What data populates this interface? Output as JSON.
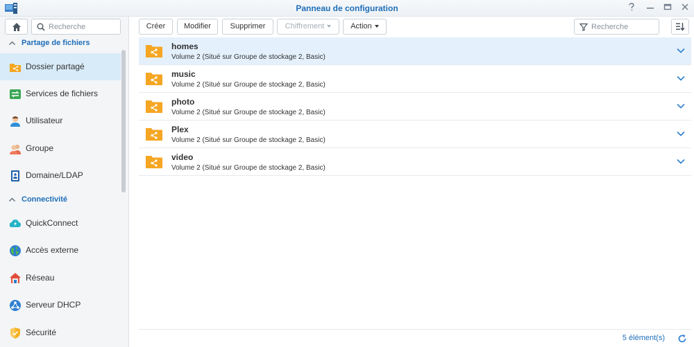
{
  "window": {
    "title": "Panneau de configuration",
    "controls": [
      "help-icon",
      "minimize-icon",
      "maximize-icon",
      "close-icon"
    ]
  },
  "sidebar": {
    "search_placeholder": "Recherche",
    "sections": [
      {
        "label": "Partage de fichiers",
        "items": [
          {
            "label": "Dossier partagé",
            "icon": "shared-folder-icon",
            "active": true
          },
          {
            "label": "Services de fichiers",
            "icon": "file-services-icon"
          },
          {
            "label": "Utilisateur",
            "icon": "user-icon"
          },
          {
            "label": "Groupe",
            "icon": "group-icon"
          },
          {
            "label": "Domaine/LDAP",
            "icon": "domain-ldap-icon"
          }
        ]
      },
      {
        "label": "Connectivité",
        "items": [
          {
            "label": "QuickConnect",
            "icon": "quickconnect-icon"
          },
          {
            "label": "Accès externe",
            "icon": "external-access-icon"
          },
          {
            "label": "Réseau",
            "icon": "network-icon"
          },
          {
            "label": "Serveur DHCP",
            "icon": "dhcp-server-icon"
          },
          {
            "label": "Sécurité",
            "icon": "security-icon"
          }
        ]
      }
    ]
  },
  "toolbar": {
    "create": "Créer",
    "edit": "Modifier",
    "delete": "Supprimer",
    "encryption": "Chiffrement",
    "action": "Action",
    "filter_placeholder": "Recherche"
  },
  "folders": [
    {
      "name": "homes",
      "description": "Volume 2 (Situé sur Groupe de stockage 2, Basic)",
      "selected": true
    },
    {
      "name": "music",
      "description": "Volume 2 (Situé sur Groupe de stockage 2, Basic)"
    },
    {
      "name": "photo",
      "description": "Volume 2 (Situé sur Groupe de stockage 2, Basic)"
    },
    {
      "name": "Plex",
      "description": "Volume 2 (Situé sur Groupe de stockage 2, Basic)"
    },
    {
      "name": "video",
      "description": "Volume 2 (Situé sur Groupe de stockage 2, Basic)"
    }
  ],
  "footer": {
    "count": "5 élément(s)"
  },
  "colors": {
    "accent": "#1f6eb8",
    "folder": "#f5a623",
    "selected_row": "#e4f0fb",
    "active_nav": "#d8ebf9"
  }
}
